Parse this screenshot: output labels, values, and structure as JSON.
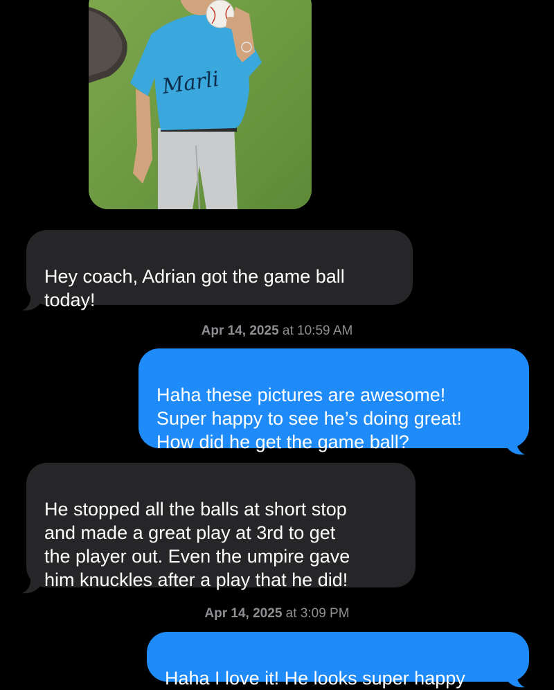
{
  "messages": [
    {
      "type": "received",
      "text": "Hey coach, Adrian got the game ball\ntoday!"
    },
    {
      "type": "timestamp",
      "date": "Apr 14, 2025",
      "time": "at 10:59 AM"
    },
    {
      "type": "sent",
      "text": "Haha these pictures are awesome!\nSuper happy to see he’s doing great!\nHow did he get the game ball?"
    },
    {
      "type": "received",
      "text": "He stopped all the balls at short stop\nand made a great play at 3rd to get\nthe player out.  Even the umpire gave\nhim knuckles after a play that he did!"
    },
    {
      "type": "timestamp",
      "date": "Apr 14, 2025",
      "time": "at 3:09 PM"
    },
    {
      "type": "sent",
      "text": "Haha I love it! He looks super happy"
    }
  ],
  "photo": {
    "jersey_text": "Marli",
    "jersey_color": "#3aa7dd",
    "grass_color": "#6d9a42"
  },
  "colors": {
    "background": "#000000",
    "received_bubble": "#262628",
    "sent_bubble": "#1f8bf8",
    "timestamp": "#8e8e93"
  }
}
